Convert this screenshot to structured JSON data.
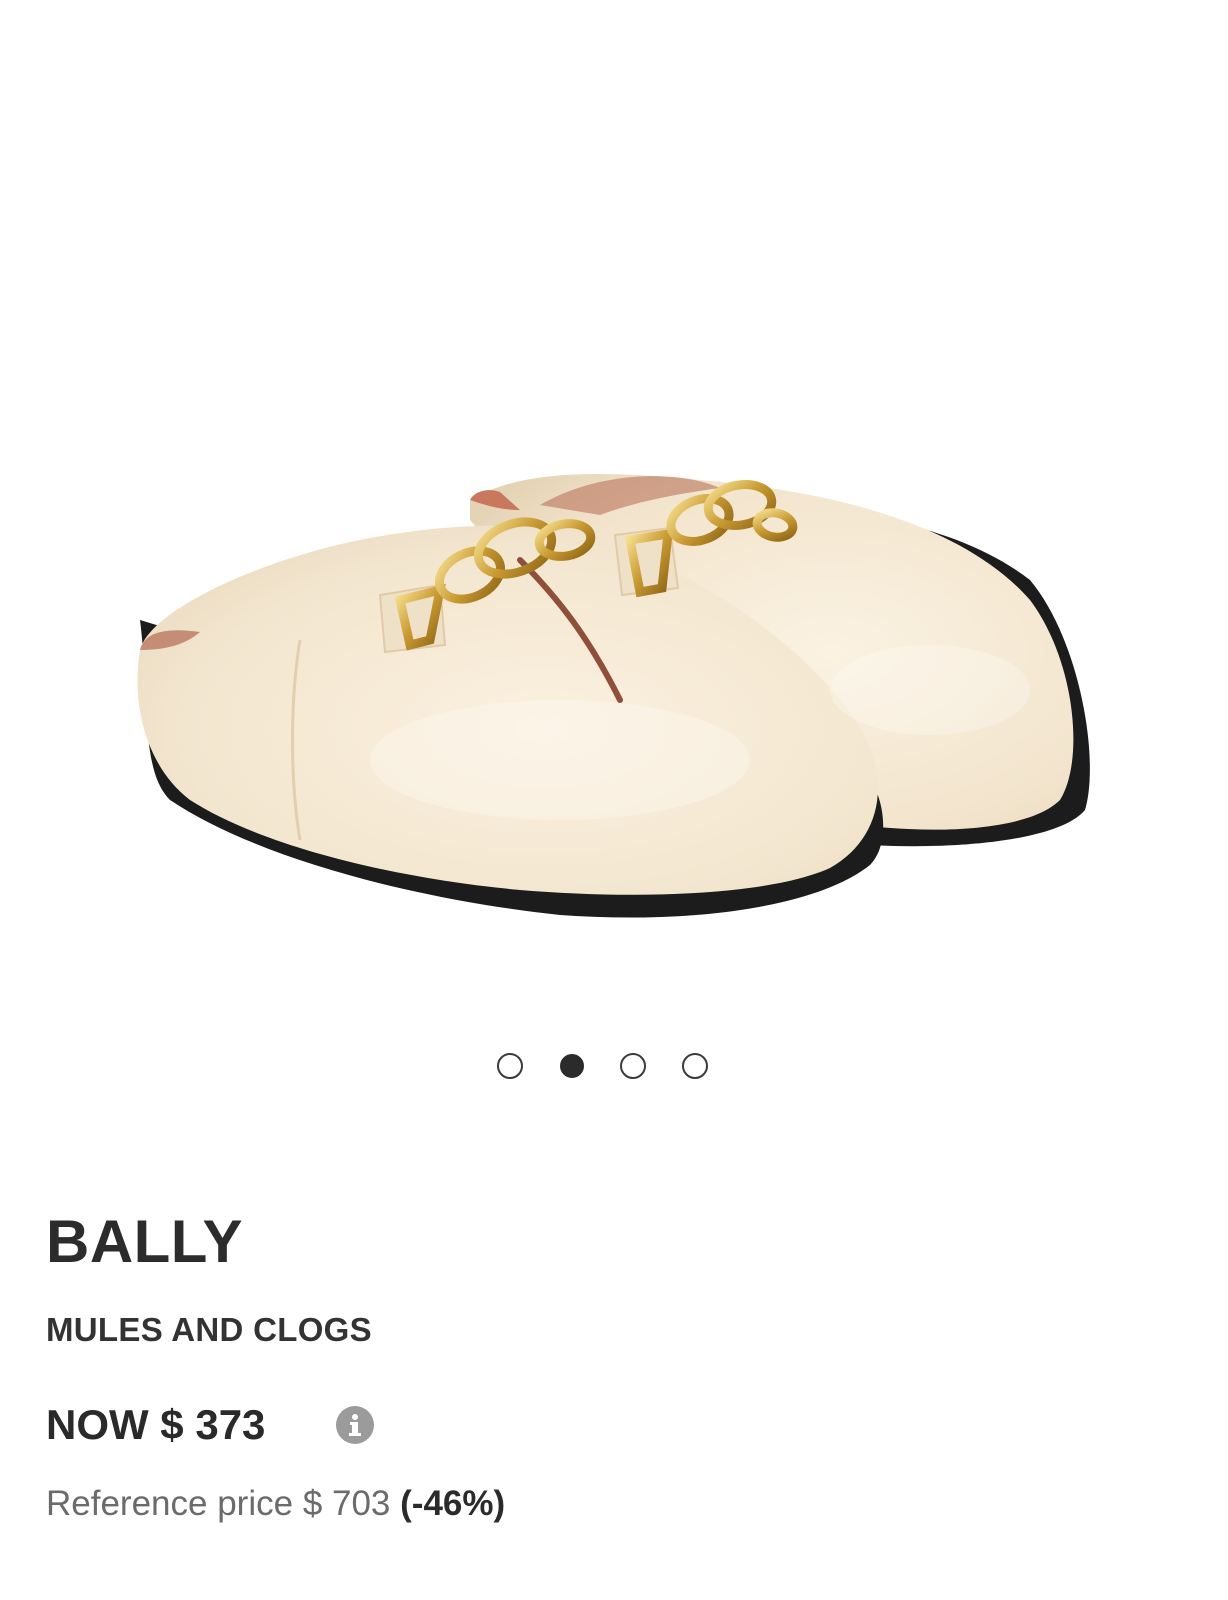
{
  "product": {
    "image_alt": "Bally mules and clogs",
    "brand": "BALLY",
    "category": "MULES AND CLOGS"
  },
  "gallery": {
    "slide_count": 4,
    "active_index": 1
  },
  "pricing": {
    "now_price": "NOW $ 373",
    "reference_label": "Reference price",
    "reference_price": "$ 703",
    "discount": "(-46%)",
    "highlight_color": "#fbf59b"
  },
  "icons": {
    "info": "info-icon"
  }
}
